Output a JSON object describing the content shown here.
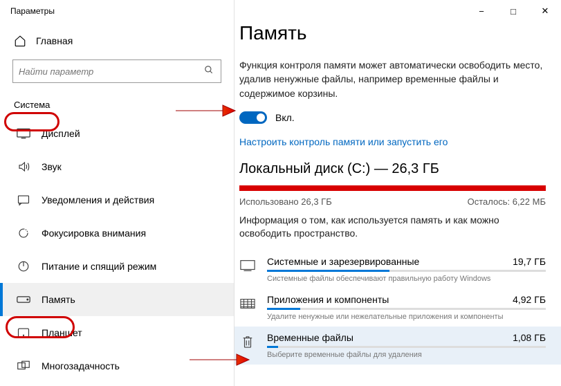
{
  "window_title": "Параметры",
  "home_label": "Главная",
  "search_placeholder": "Найти параметр",
  "category": "Система",
  "nav": [
    {
      "label": "Дисплей",
      "icon": "display"
    },
    {
      "label": "Звук",
      "icon": "sound"
    },
    {
      "label": "Уведомления и действия",
      "icon": "notify"
    },
    {
      "label": "Фокусировка внимания",
      "icon": "focus"
    },
    {
      "label": "Питание и спящий режим",
      "icon": "power"
    },
    {
      "label": "Память",
      "icon": "storage"
    },
    {
      "label": "Планшет",
      "icon": "tablet"
    },
    {
      "label": "Многозадачность",
      "icon": "multi"
    }
  ],
  "page": {
    "title": "Память",
    "desc": "Функция контроля памяти может автоматически освободить место, удалив ненужные файлы, например временные файлы и содержимое корзины.",
    "toggle_label": "Вкл.",
    "link": "Настроить контроль памяти или запустить его",
    "disk_title": "Локальный диск (C:) — 26,3 ГБ",
    "used": "Использовано 26,3 ГБ",
    "free": "Осталось: 6,22 МБ",
    "info": "Информация о том, как используется память и как можно освободить пространство.",
    "items": [
      {
        "name": "Системные и зарезервированные",
        "size": "19,7 ГБ",
        "sub": "Системные файлы обеспечивают правильную работу Windows",
        "fill": 44
      },
      {
        "name": "Приложения и компоненты",
        "size": "4,92 ГБ",
        "sub": "Удалите ненужные или нежелательные приложения и компоненты",
        "fill": 12
      },
      {
        "name": "Временные файлы",
        "size": "1,08 ГБ",
        "sub": "Выберите временные файлы для удаления",
        "fill": 4
      }
    ]
  }
}
